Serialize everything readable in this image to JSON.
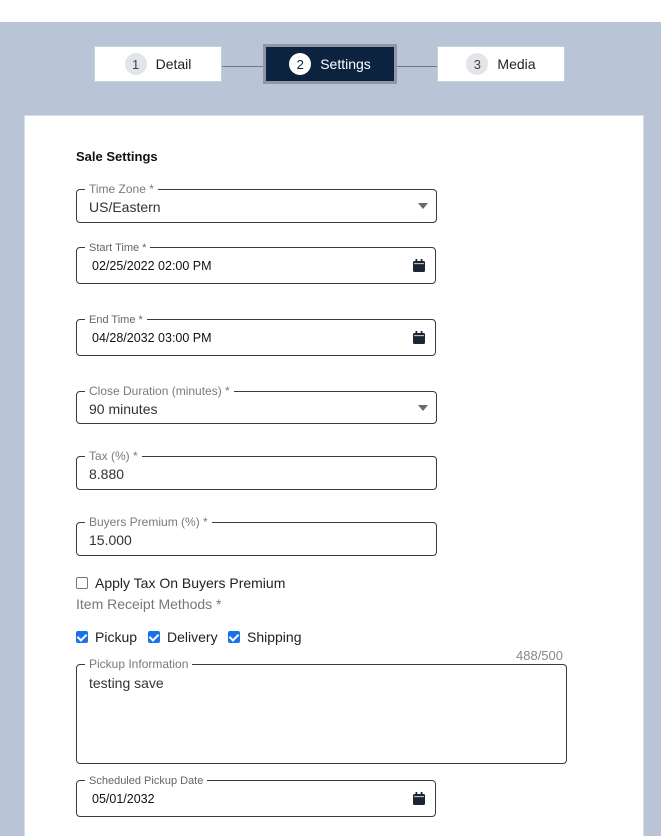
{
  "stepper": {
    "steps": [
      {
        "number": "1",
        "label": "Detail"
      },
      {
        "number": "2",
        "label": "Settings"
      },
      {
        "number": "3",
        "label": "Media"
      }
    ],
    "active_step": 2
  },
  "form": {
    "section_title": "Sale Settings",
    "time_zone": {
      "label": "Time Zone *",
      "value": "US/Eastern"
    },
    "start_time": {
      "label": "Start Time *",
      "value": "02/25/2022 02:00 PM"
    },
    "end_time": {
      "label": "End Time *",
      "value": "04/28/2032 03:00 PM"
    },
    "close_duration": {
      "label": "Close Duration (minutes) *",
      "value": "90 minutes"
    },
    "tax": {
      "label": "Tax (%) *",
      "value": "8.880"
    },
    "buyers_premium": {
      "label": "Buyers Premium (%) *",
      "value": "15.000"
    },
    "apply_tax": {
      "label": "Apply Tax On Buyers Premium",
      "checked": false
    },
    "receipt_methods_label": "Item Receipt Methods *",
    "receipt_methods": [
      {
        "label": "Pickup",
        "checked": true
      },
      {
        "label": "Delivery",
        "checked": true
      },
      {
        "label": "Shipping",
        "checked": true
      }
    ],
    "pickup_info": {
      "label": "Pickup Information",
      "value": "testing save",
      "counter": "488/500"
    },
    "scheduled_pickup_date": {
      "label": "Scheduled Pickup Date",
      "value": "05/01/2032"
    }
  },
  "colors": {
    "background": "#b9c5d6",
    "active_step": "#0c2340",
    "checkbox": "#1a73e8"
  }
}
